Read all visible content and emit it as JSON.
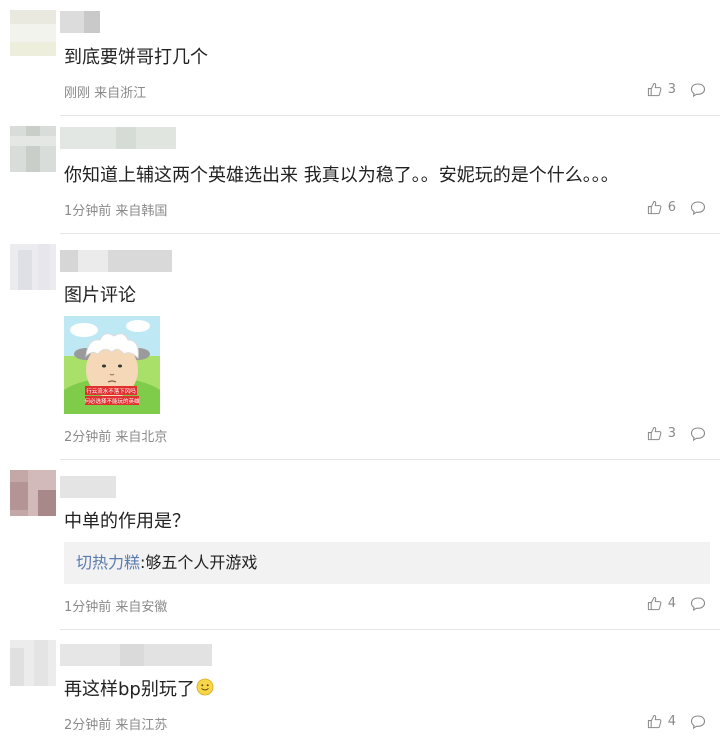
{
  "comments": [
    {
      "text": "到底要饼哥打几个",
      "time": "刚刚 来自浙江",
      "likes": "3"
    },
    {
      "text": "你知道上辅这两个英雄选出来 我真以为稳了。。安妮玩的是个什么。。。",
      "time": "1分钟前 来自韩国",
      "likes": "6"
    },
    {
      "text": "图片评论",
      "time": "2分钟前 来自北京",
      "likes": "3"
    },
    {
      "text": "中单的作用是？",
      "time": "1分钟前 来自安徽",
      "likes": "4",
      "quote": {
        "author": "切热力糕",
        "body": ":够五个人开游戏"
      }
    },
    {
      "text": "再这样bp别玩了",
      "time": "2分钟前 来自江苏",
      "likes": "4"
    }
  ],
  "image_caption_lines": [
    "行云流水不落下风吗",
    "何必选择不能玩的英雄"
  ],
  "icons": {
    "like": "thumbs-up-icon",
    "reply": "comment-bubble-icon",
    "emoji": "smile-emoji-icon"
  },
  "colors": {
    "meta": "#8a8a8a",
    "link": "#5b7cb0",
    "quote_bg": "#f2f2f2",
    "divider": "#e6e6e6"
  }
}
